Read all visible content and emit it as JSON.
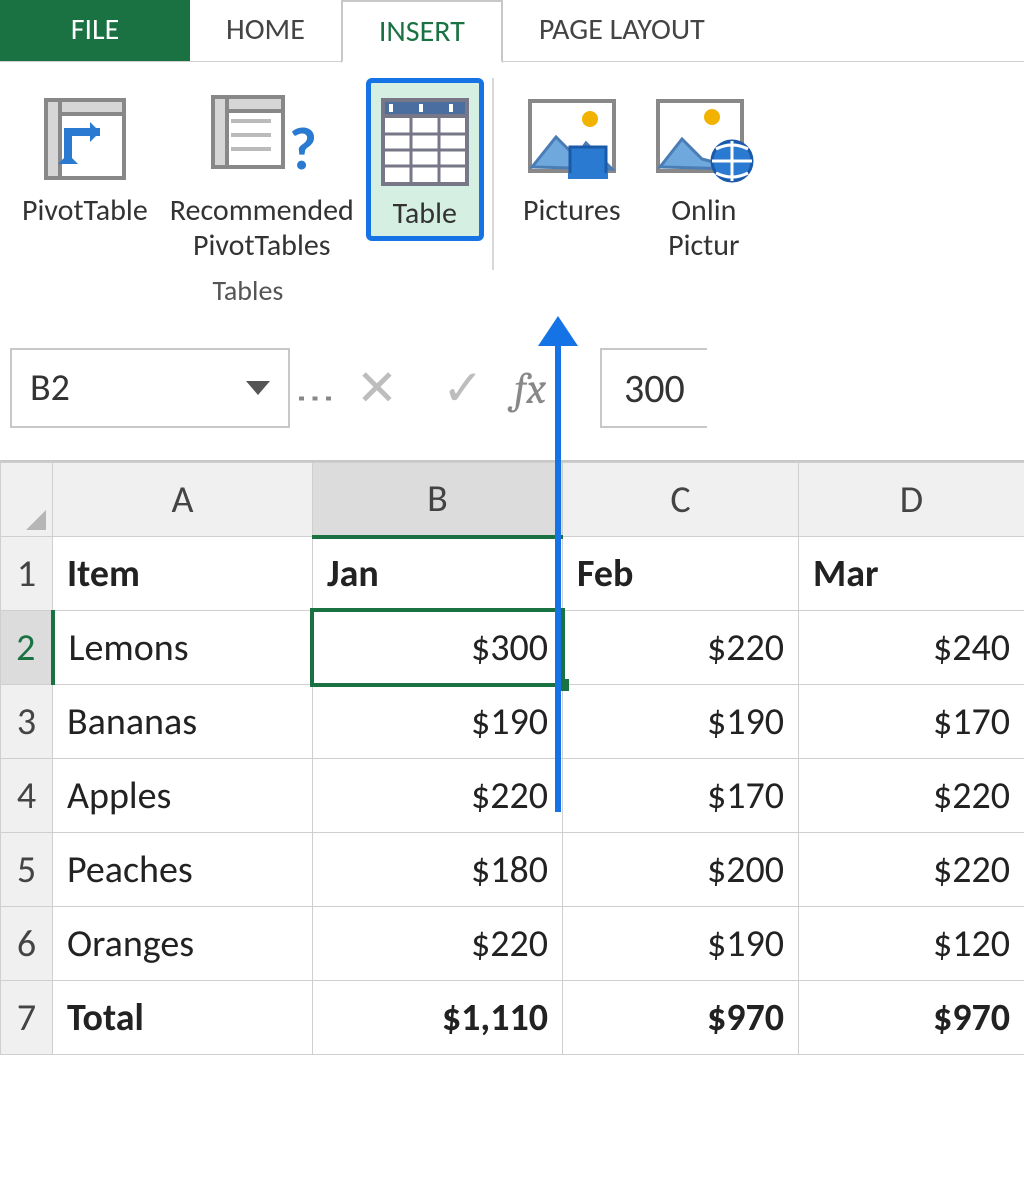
{
  "tabs": {
    "file": "FILE",
    "home": "HOME",
    "insert": "INSERT",
    "pagelayout": "PAGE LAYOUT"
  },
  "ribbon": {
    "group_tables_label": "Tables",
    "pivottable": "PivotTable",
    "recommended_pivottables_line1": "Recommended",
    "recommended_pivottables_line2": "PivotTables",
    "table": "Table",
    "pictures": "Pictures",
    "online_pictures_line1": "Onlin",
    "online_pictures_line2": "Pictur"
  },
  "formula_bar": {
    "name_box": "B2",
    "fx_label": "fx",
    "value": "300"
  },
  "columns": [
    "A",
    "B",
    "C",
    "D"
  ],
  "selected_column_index": 1,
  "selected_row_number": "2",
  "row_headers": [
    "1",
    "2",
    "3",
    "4",
    "5",
    "6",
    "7"
  ],
  "cells": {
    "r1": {
      "A": "Item",
      "B": "Jan",
      "C": "Feb",
      "D": "Mar"
    },
    "r2": {
      "A": "Lemons",
      "B": "$300",
      "C": "$220",
      "D": "$240"
    },
    "r3": {
      "A": "Bananas",
      "B": "$190",
      "C": "$190",
      "D": "$170"
    },
    "r4": {
      "A": "Apples",
      "B": "$220",
      "C": "$170",
      "D": "$220"
    },
    "r5": {
      "A": "Peaches",
      "B": "$180",
      "C": "$200",
      "D": "$220"
    },
    "r6": {
      "A": "Oranges",
      "B": "$220",
      "C": "$190",
      "D": "$120"
    },
    "r7": {
      "A": "Total",
      "B": "$1,110",
      "C": "$970",
      "D": "$970"
    }
  },
  "colors": {
    "accent_green": "#1a7243",
    "highlight_blue": "#1573e6"
  }
}
